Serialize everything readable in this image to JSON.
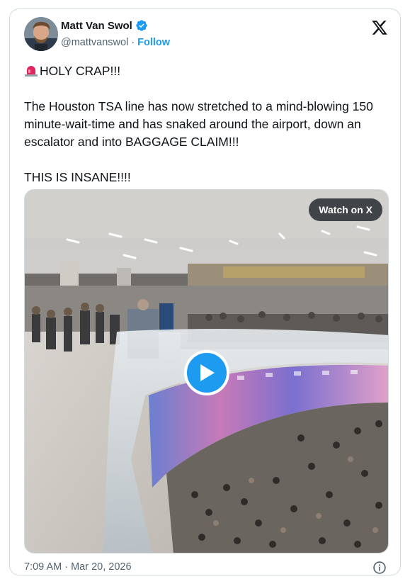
{
  "author": {
    "display_name": "Matt Van Swol",
    "handle": "@mattvanswol",
    "separator": "·",
    "follow_label": "Follow",
    "verified": true,
    "badge_color": "#1d9bf0"
  },
  "post": {
    "headline": "HOLY CRAP!!!",
    "body": "The Houston TSA line has now stretched to a mind-blowing 150 minute-wait-time and has snaked around the airport, down an escalator and into BAGGAGE CLAIM!!!",
    "closing": "THIS IS INSANE!!!!",
    "emoji_icon": "police-siren-icon"
  },
  "media": {
    "watch_label": "Watch on X",
    "play_icon": "play-icon"
  },
  "footer": {
    "timestamp": "7:09 AM · Mar 20, 2026",
    "info_icon": "info-icon"
  },
  "colors": {
    "accent": "#1d9bf0",
    "text": "#0f1419",
    "muted": "#536471",
    "border": "#cfd9de"
  }
}
